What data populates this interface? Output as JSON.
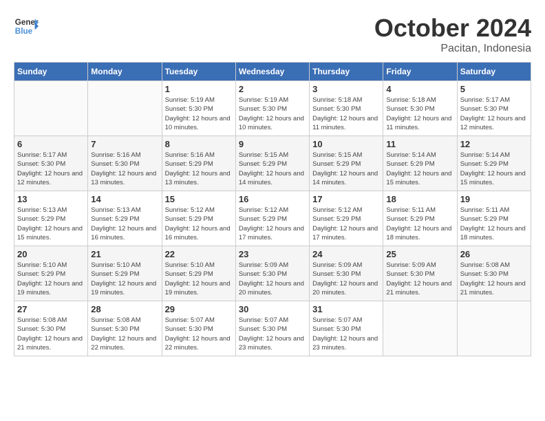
{
  "header": {
    "logo_line1": "General",
    "logo_line2": "Blue",
    "month": "October 2024",
    "location": "Pacitan, Indonesia"
  },
  "weekdays": [
    "Sunday",
    "Monday",
    "Tuesday",
    "Wednesday",
    "Thursday",
    "Friday",
    "Saturday"
  ],
  "weeks": [
    [
      {
        "day": "",
        "info": ""
      },
      {
        "day": "",
        "info": ""
      },
      {
        "day": "1",
        "info": "Sunrise: 5:19 AM\nSunset: 5:30 PM\nDaylight: 12 hours\nand 10 minutes."
      },
      {
        "day": "2",
        "info": "Sunrise: 5:19 AM\nSunset: 5:30 PM\nDaylight: 12 hours\nand 10 minutes."
      },
      {
        "day": "3",
        "info": "Sunrise: 5:18 AM\nSunset: 5:30 PM\nDaylight: 12 hours\nand 11 minutes."
      },
      {
        "day": "4",
        "info": "Sunrise: 5:18 AM\nSunset: 5:30 PM\nDaylight: 12 hours\nand 11 minutes."
      },
      {
        "day": "5",
        "info": "Sunrise: 5:17 AM\nSunset: 5:30 PM\nDaylight: 12 hours\nand 12 minutes."
      }
    ],
    [
      {
        "day": "6",
        "info": "Sunrise: 5:17 AM\nSunset: 5:30 PM\nDaylight: 12 hours\nand 12 minutes."
      },
      {
        "day": "7",
        "info": "Sunrise: 5:16 AM\nSunset: 5:30 PM\nDaylight: 12 hours\nand 13 minutes."
      },
      {
        "day": "8",
        "info": "Sunrise: 5:16 AM\nSunset: 5:29 PM\nDaylight: 12 hours\nand 13 minutes."
      },
      {
        "day": "9",
        "info": "Sunrise: 5:15 AM\nSunset: 5:29 PM\nDaylight: 12 hours\nand 14 minutes."
      },
      {
        "day": "10",
        "info": "Sunrise: 5:15 AM\nSunset: 5:29 PM\nDaylight: 12 hours\nand 14 minutes."
      },
      {
        "day": "11",
        "info": "Sunrise: 5:14 AM\nSunset: 5:29 PM\nDaylight: 12 hours\nand 15 minutes."
      },
      {
        "day": "12",
        "info": "Sunrise: 5:14 AM\nSunset: 5:29 PM\nDaylight: 12 hours\nand 15 minutes."
      }
    ],
    [
      {
        "day": "13",
        "info": "Sunrise: 5:13 AM\nSunset: 5:29 PM\nDaylight: 12 hours\nand 15 minutes."
      },
      {
        "day": "14",
        "info": "Sunrise: 5:13 AM\nSunset: 5:29 PM\nDaylight: 12 hours\nand 16 minutes."
      },
      {
        "day": "15",
        "info": "Sunrise: 5:12 AM\nSunset: 5:29 PM\nDaylight: 12 hours\nand 16 minutes."
      },
      {
        "day": "16",
        "info": "Sunrise: 5:12 AM\nSunset: 5:29 PM\nDaylight: 12 hours\nand 17 minutes."
      },
      {
        "day": "17",
        "info": "Sunrise: 5:12 AM\nSunset: 5:29 PM\nDaylight: 12 hours\nand 17 minutes."
      },
      {
        "day": "18",
        "info": "Sunrise: 5:11 AM\nSunset: 5:29 PM\nDaylight: 12 hours\nand 18 minutes."
      },
      {
        "day": "19",
        "info": "Sunrise: 5:11 AM\nSunset: 5:29 PM\nDaylight: 12 hours\nand 18 minutes."
      }
    ],
    [
      {
        "day": "20",
        "info": "Sunrise: 5:10 AM\nSunset: 5:29 PM\nDaylight: 12 hours\nand 19 minutes."
      },
      {
        "day": "21",
        "info": "Sunrise: 5:10 AM\nSunset: 5:29 PM\nDaylight: 12 hours\nand 19 minutes."
      },
      {
        "day": "22",
        "info": "Sunrise: 5:10 AM\nSunset: 5:29 PM\nDaylight: 12 hours\nand 19 minutes."
      },
      {
        "day": "23",
        "info": "Sunrise: 5:09 AM\nSunset: 5:30 PM\nDaylight: 12 hours\nand 20 minutes."
      },
      {
        "day": "24",
        "info": "Sunrise: 5:09 AM\nSunset: 5:30 PM\nDaylight: 12 hours\nand 20 minutes."
      },
      {
        "day": "25",
        "info": "Sunrise: 5:09 AM\nSunset: 5:30 PM\nDaylight: 12 hours\nand 21 minutes."
      },
      {
        "day": "26",
        "info": "Sunrise: 5:08 AM\nSunset: 5:30 PM\nDaylight: 12 hours\nand 21 minutes."
      }
    ],
    [
      {
        "day": "27",
        "info": "Sunrise: 5:08 AM\nSunset: 5:30 PM\nDaylight: 12 hours\nand 21 minutes."
      },
      {
        "day": "28",
        "info": "Sunrise: 5:08 AM\nSunset: 5:30 PM\nDaylight: 12 hours\nand 22 minutes."
      },
      {
        "day": "29",
        "info": "Sunrise: 5:07 AM\nSunset: 5:30 PM\nDaylight: 12 hours\nand 22 minutes."
      },
      {
        "day": "30",
        "info": "Sunrise: 5:07 AM\nSunset: 5:30 PM\nDaylight: 12 hours\nand 23 minutes."
      },
      {
        "day": "31",
        "info": "Sunrise: 5:07 AM\nSunset: 5:30 PM\nDaylight: 12 hours\nand 23 minutes."
      },
      {
        "day": "",
        "info": ""
      },
      {
        "day": "",
        "info": ""
      }
    ]
  ]
}
